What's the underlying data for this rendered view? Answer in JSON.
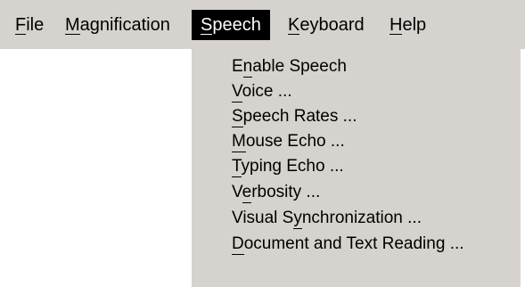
{
  "menubar": {
    "items": [
      {
        "label": "File",
        "mnemonic_index": 0
      },
      {
        "label": "Magnification",
        "mnemonic_index": 0
      },
      {
        "label": "Speech",
        "mnemonic_index": 0,
        "active": true
      },
      {
        "label": "Keyboard",
        "mnemonic_index": 0
      },
      {
        "label": "Help",
        "mnemonic_index": 0
      }
    ]
  },
  "speech_menu": {
    "items": [
      {
        "label": "Enable Speech",
        "mnemonic_index": 1
      },
      {
        "label": "Voice ...",
        "mnemonic_index": 0
      },
      {
        "label": "Speech Rates ...",
        "mnemonic_index": 0
      },
      {
        "label": "Mouse Echo ...",
        "mnemonic_index": 0
      },
      {
        "label": "Typing Echo ...",
        "mnemonic_index": 0
      },
      {
        "label": "Verbosity ...",
        "mnemonic_index": 1
      },
      {
        "label": "Visual Synchronization ...",
        "mnemonic_index": 8
      },
      {
        "label": "Document and Text Reading ...",
        "mnemonic_index": 0
      }
    ]
  },
  "colors": {
    "menu_background": "#d6d3ce",
    "active_background": "#000000",
    "active_text": "#ffffff",
    "text": "#000000"
  }
}
